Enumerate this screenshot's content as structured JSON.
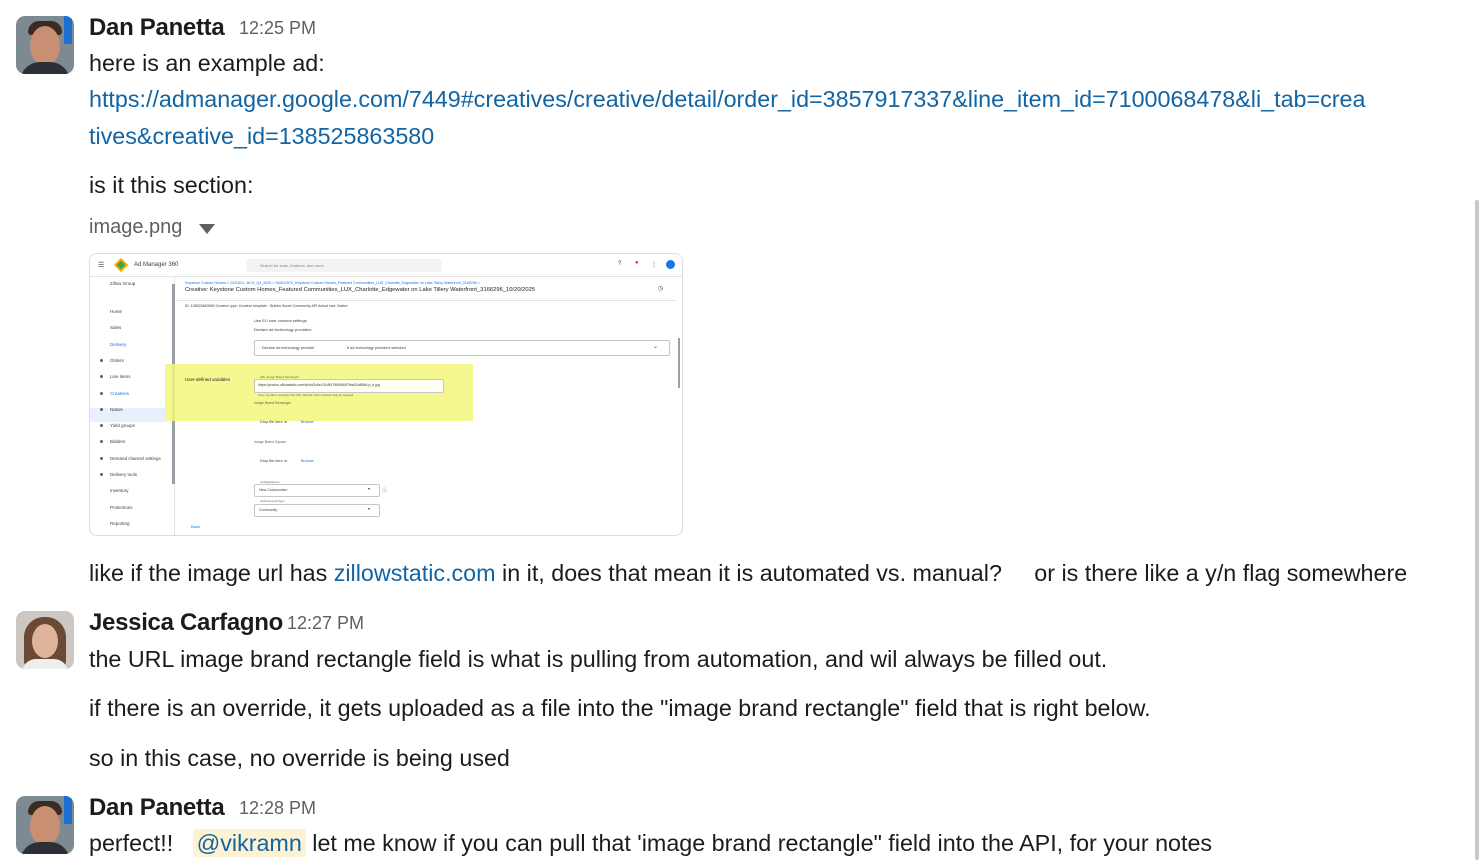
{
  "messages": [
    {
      "author": "Dan Panetta",
      "time": "12:25 PM",
      "line1": "here is an example ad:",
      "link_part1": "https://admanager.google.com/7449#creatives/creative/detail/order_id=3857917337&line_item_id=7100068478&li_tab=crea",
      "link_part2": "tives&creative_id=138525863580",
      "line3": "is it this section:",
      "attachment_name": "image.png",
      "line4_before": "like if the image url has ",
      "line4_link": "zillowstatic.com",
      "line4_after": " in it, does that mean it is automated vs. manual?     or is there like a y/n flag somewhere"
    },
    {
      "author": "Jessica Carfagno",
      "time": "12:27 PM",
      "line1": "the URL image brand rectangle field is what is pulling from automation, and wil always be filled out.",
      "line2": "if there is an override, it gets uploaded as a file into the \"image brand rectangle\" field that is right below.",
      "line3": "so in this case, no override is being used"
    },
    {
      "author": "Dan Panetta",
      "time": "12:28 PM",
      "line_before": "perfect!!   ",
      "mention": "@vikramn",
      "line_after": " let me know if you can pull that 'image brand rectangle\" field into the API, for your notes"
    }
  ],
  "thumbnail": {
    "app_name": "Ad Manager 360",
    "search_placeholder": "Search for tools, features, and more",
    "network": "Zillow Group",
    "breadcrumb": "Keystone Custom Homes > 2331814...BCH_Q4_2025 > 250611570_Keystone Custom Homes_Featured Communities_LUX_Charlotte_Edgewater on Lake Tillery Waterfront_3166296 >",
    "creative_title": "Creative: Keystone Custom Homes_Featured Communities_LUX_Charlotte_Edgewater on Lake Tillery Waterfront_3166296_10/20/2025",
    "meta": "ID: 138525863580    Creative type: Creative template · Builder Boost Community API    Actual size: Native",
    "consent1": "Use EU user consent settings",
    "consent2": "Declare ad technology providers",
    "provider_label": "Declare ad technology provider",
    "provider_value": "6 ad technology providers selected",
    "udv_label": "User-defined variables",
    "url_field_label": "URL Image Brand Rectangle*",
    "url_field_value": "https://photos.zillowstatic.com/fp/bd3c5e101d547980f6657fba02d898d-p_e.jpg",
    "url_note": "Sorry, we didn't recognize this URL. Manual macro insertion may be required",
    "rect_label": "Image Brand Rectangle",
    "drop1": "Drop file here or",
    "browse1": "Browse",
    "square_label": "Image Brand Square",
    "drop2": "Drop file here or",
    "browse2": "Browse",
    "flag_label": "ListFlagOptions",
    "flag_value": "New Construction",
    "type_label": "ListCommunityType",
    "type_value": "Community",
    "back": "Back",
    "nav": [
      "Home",
      "Sales",
      "Delivery",
      "Orders",
      "Line items",
      "Creatives",
      "Native",
      "Yield groups",
      "Bidders",
      "Demand channel settings",
      "Delivery tools",
      "Inventory",
      "Protections",
      "Reporting"
    ]
  }
}
